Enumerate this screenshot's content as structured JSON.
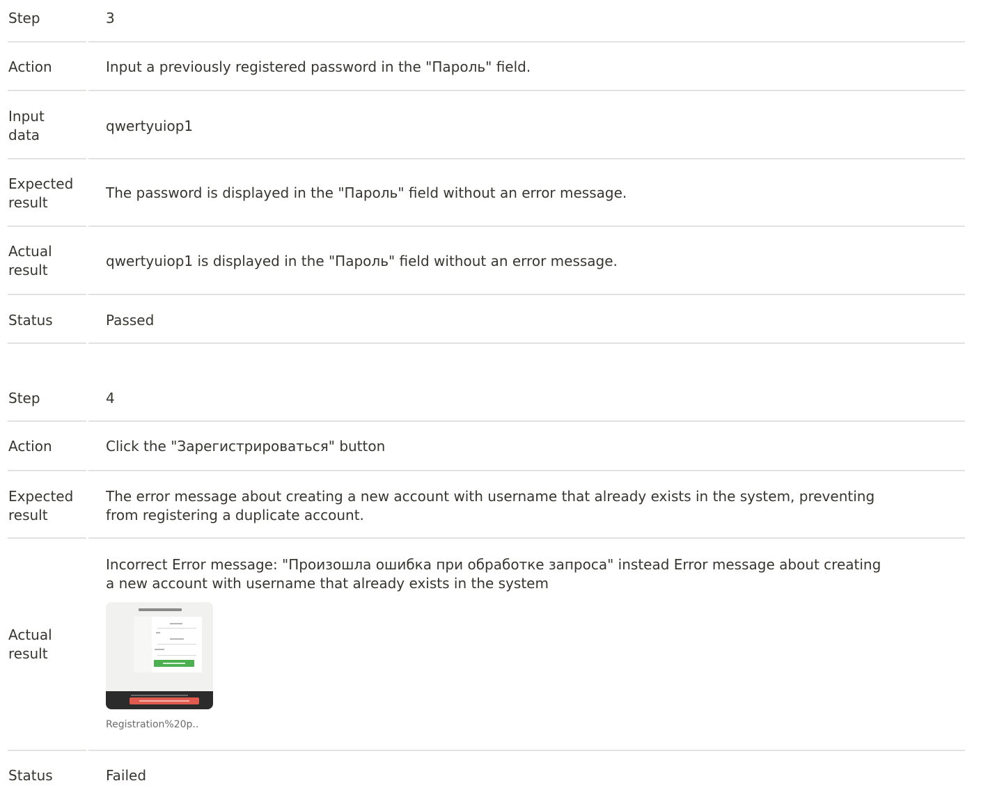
{
  "step3": {
    "step_label": "Step",
    "step_value": "3",
    "action_label": "Action",
    "action_value": "Input a previously registered password in the \"Пароль\" field.",
    "input_label_line1": "Input",
    "input_label_line2": "data",
    "input_value": "qwertyuiop1",
    "expected_label_line1": "Expected",
    "expected_label_line2": "result",
    "expected_value": "The password is displayed in the \"Пароль\" field without an error message.",
    "actual_label_line1": "Actual",
    "actual_label_line2": "result",
    "actual_value": "qwertyuiop1 is displayed in the \"Пароль\" field without an error message.",
    "status_label": "Status",
    "status_value": "Passed"
  },
  "step4": {
    "step_label": "Step",
    "step_value": "4",
    "action_label": "Action",
    "action_value": "Click the \"Зарегистрироваться\" button",
    "expected_label_line1": "Expected",
    "expected_label_line2": "result",
    "expected_value_line1": "The error message about creating a new account with username that already exists in the system, preventing",
    "expected_value_line2": "from registering a duplicate account.",
    "actual_label_line1": "Actual",
    "actual_label_line2": "result",
    "actual_value_line1": "Incorrect Error message: \"Произошла ошибка при обработке запроса\" instead Error message about creating",
    "actual_value_line2": "a new account with username that already exists in the system",
    "attachment_caption": "Registration%20p..",
    "status_label": "Status",
    "status_value": "Failed"
  },
  "colors": {
    "text": "#37352f",
    "divider": "#e3e2e0",
    "thumb_bg": "#f1f1ef",
    "thumb_button_green": "#4caf50",
    "thumb_error_red": "#e05a4e",
    "thumb_dark_bar": "#2b2b2b"
  }
}
